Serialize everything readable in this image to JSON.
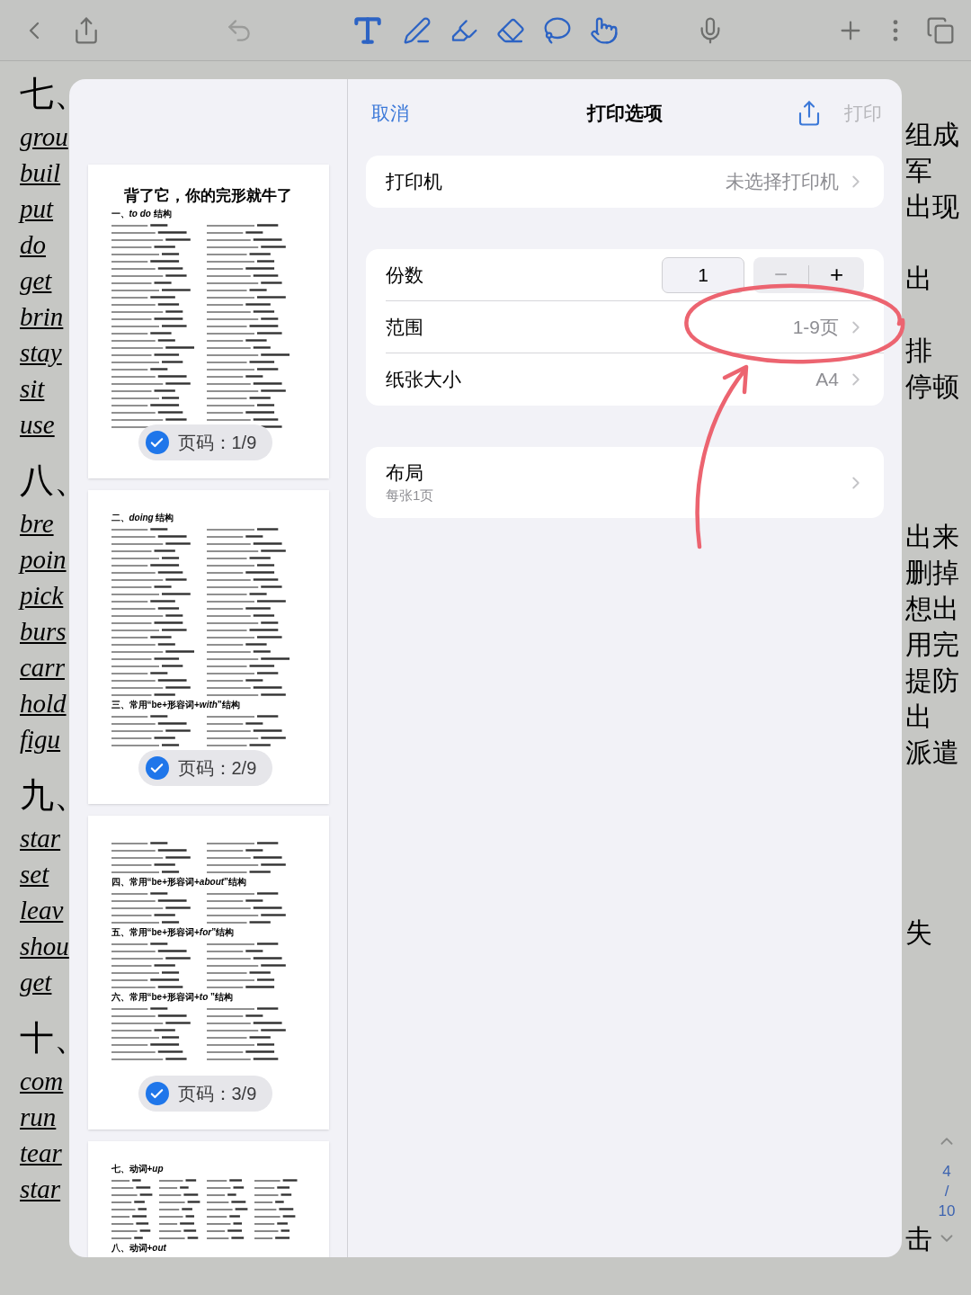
{
  "toolbar": {
    "left": [
      {
        "kind": "back"
      },
      {
        "kind": "share"
      },
      {
        "kind": "undo",
        "disabled": true
      }
    ],
    "tools": [
      {
        "kind": "text"
      },
      {
        "kind": "pen"
      },
      {
        "kind": "highlighter"
      },
      {
        "kind": "eraser"
      },
      {
        "kind": "lasso"
      },
      {
        "kind": "hand"
      }
    ],
    "right": [
      {
        "kind": "mic"
      },
      {
        "kind": "add"
      },
      {
        "kind": "more"
      },
      {
        "kind": "pages"
      }
    ]
  },
  "notes_left": [
    {
      "heading": "七、",
      "words": [
        "grou",
        "buil",
        "put",
        "do",
        "get",
        "brin",
        "stay",
        "sit",
        "use"
      ]
    },
    {
      "heading": "八、",
      "words": [
        "bre",
        "poin",
        "pick",
        "burs",
        "carr",
        "hold",
        "figu"
      ]
    },
    {
      "heading": "九、",
      "words": [
        "star",
        "set",
        "leav",
        "shou",
        "get"
      ]
    },
    {
      "heading": "十、",
      "words": [
        "com",
        "run",
        "tear",
        "star"
      ]
    }
  ],
  "notes_right": [
    "组成",
    "军",
    "出现",
    "出",
    "排",
    "停顿",
    "出来",
    "删掉",
    "想出",
    "用完",
    "提防",
    "出",
    "派遣",
    "失",
    "击"
  ],
  "page_indicator": {
    "current": "4",
    "separator": "/",
    "total": "10"
  },
  "preview": {
    "pages": [
      {
        "badge": "页码：1/9",
        "selected": true,
        "blocks": [
          {
            "kind": "title",
            "text": "背了它，你的完形就牛了"
          },
          {
            "kind": "heading",
            "text": "一、*to do* 结构"
          },
          {
            "kind": "fulllist"
          }
        ]
      },
      {
        "badge": "页码：2/9",
        "selected": true,
        "blocks": [
          {
            "kind": "heading",
            "text": "二、*doing* 结构"
          },
          {
            "kind": "longlist"
          },
          {
            "kind": "heading",
            "text": "三、常用“be+形容词+*with*”结构"
          },
          {
            "kind": "shortlist"
          }
        ]
      },
      {
        "badge": "页码：3/9",
        "selected": true,
        "blocks": [
          {
            "kind": "shortlist"
          },
          {
            "kind": "heading",
            "text": "四、常用“be+形容词+*about*”结构"
          },
          {
            "kind": "shortlist"
          },
          {
            "kind": "heading",
            "text": "五、常用“be+形容词+*for*”结构"
          },
          {
            "kind": "midlist"
          },
          {
            "kind": "heading",
            "text": "六、常用“be+形容词+*to* ”结构"
          },
          {
            "kind": "list"
          }
        ]
      },
      {
        "blocks": [
          {
            "kind": "heading",
            "text": "七、动词+*up*"
          },
          {
            "kind": "grid"
          },
          {
            "kind": "heading",
            "text": "八、动词+*out*"
          }
        ]
      }
    ]
  },
  "dialog": {
    "cancel": "取消",
    "title": "打印选项",
    "print": {
      "label": "打印",
      "disabled": true
    },
    "printer": {
      "label": "打印机",
      "value": "未选择打印机"
    },
    "copies": {
      "label": "份数",
      "value": "1",
      "minus": {
        "label": "−",
        "disabled": true
      },
      "plus": {
        "label": "+",
        "disabled": false
      }
    },
    "range": {
      "label": "范围",
      "value": "1-9页"
    },
    "paper": {
      "label": "纸张大小",
      "value": "A4"
    },
    "layout": {
      "label": "布局",
      "subtitle": "每张1页"
    }
  }
}
